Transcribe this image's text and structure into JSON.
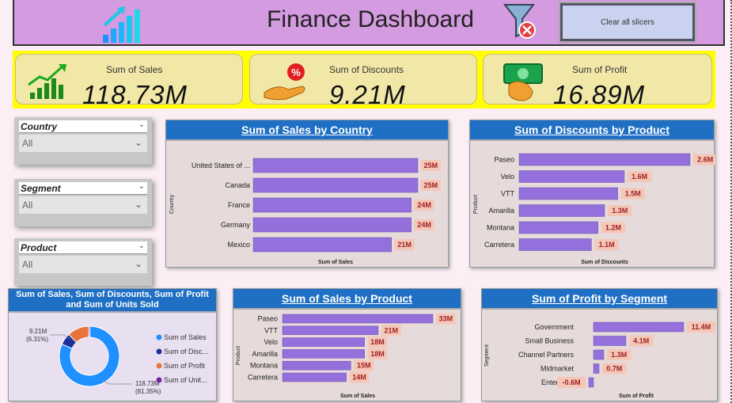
{
  "header": {
    "title": "Finance Dashboard",
    "clear_button": "Clear all slicers",
    "logo_icon": "bar-chart-growth-icon",
    "filter_icon": "filter-clear-icon"
  },
  "kpis": [
    {
      "label": "Sum of Sales",
      "value": "118.73M",
      "icon": "sales-growth-icon"
    },
    {
      "label": "Sum of Discounts",
      "value": "9.21M",
      "icon": "discount-hand-icon"
    },
    {
      "label": "Sum of Profit",
      "value": "16.89M",
      "icon": "money-hand-icon"
    }
  ],
  "slicers": [
    {
      "label": "Country",
      "value": "All"
    },
    {
      "label": "Segment",
      "value": "All"
    },
    {
      "label": "Product",
      "value": "All"
    }
  ],
  "colors": {
    "bar": "#9370db",
    "header": "#1f6fc4",
    "label_bg": "#f4c7b8"
  },
  "chart_data": [
    {
      "type": "bar",
      "title": "Sum of Sales by Country",
      "xlabel": "Sum of Sales",
      "ylabel": "Country",
      "categories": [
        "United States of ...",
        "Canada",
        "France",
        "Germany",
        "Mexico"
      ],
      "values": [
        25,
        25,
        24,
        24,
        21
      ],
      "labels": [
        "25M",
        "25M",
        "24M",
        "24M",
        "21M"
      ]
    },
    {
      "type": "bar",
      "title": "Sum of Discounts by Product",
      "xlabel": "Sum of Discounts",
      "ylabel": "Product",
      "categories": [
        "Paseo",
        "Velo",
        "VTT",
        "Amarilla",
        "Montana",
        "Carretera"
      ],
      "values": [
        2.6,
        1.6,
        1.5,
        1.3,
        1.2,
        1.1
      ],
      "labels": [
        "2.6M",
        "1.6M",
        "1.5M",
        "1.3M",
        "1.2M",
        "1.1M"
      ]
    },
    {
      "type": "pie",
      "title": "Sum of Sales, Sum of Discounts, Sum of Profit and Sum of Units Sold",
      "legend": [
        "Sum of Sales",
        "Sum of Disc...",
        "Sum of Profit",
        "Sum of Unit..."
      ],
      "values": [
        118.73,
        9.21,
        16.89,
        1.13
      ],
      "colors": [
        "#1e90ff",
        "#1a2f9a",
        "#e8743b",
        "#7b1fa2"
      ],
      "callouts": [
        {
          "value": "9.21M",
          "pct": "(6.31%)"
        },
        {
          "value": "118.73M",
          "pct": "(81.35%)"
        }
      ]
    },
    {
      "type": "bar",
      "title": "Sum of Sales by Product",
      "xlabel": "Sum of Sales",
      "ylabel": "Product",
      "categories": [
        "Paseo",
        "VTT",
        "Velo",
        "Amarilla",
        "Montana",
        "Carretera"
      ],
      "values": [
        33,
        21,
        18,
        18,
        15,
        14
      ],
      "labels": [
        "33M",
        "21M",
        "18M",
        "18M",
        "15M",
        "14M"
      ]
    },
    {
      "type": "bar",
      "title": "Sum of Profit by Segment",
      "xlabel": "Sum of Profit",
      "ylabel": "Segment",
      "categories": [
        "Government",
        "Small Business",
        "Channel Partners",
        "Midmarket",
        "Enterprise"
      ],
      "values": [
        11.4,
        4.1,
        1.3,
        0.7,
        -0.6
      ],
      "labels": [
        "11.4M",
        "4.1M",
        "1.3M",
        "0.7M",
        "-0.6M"
      ]
    }
  ]
}
